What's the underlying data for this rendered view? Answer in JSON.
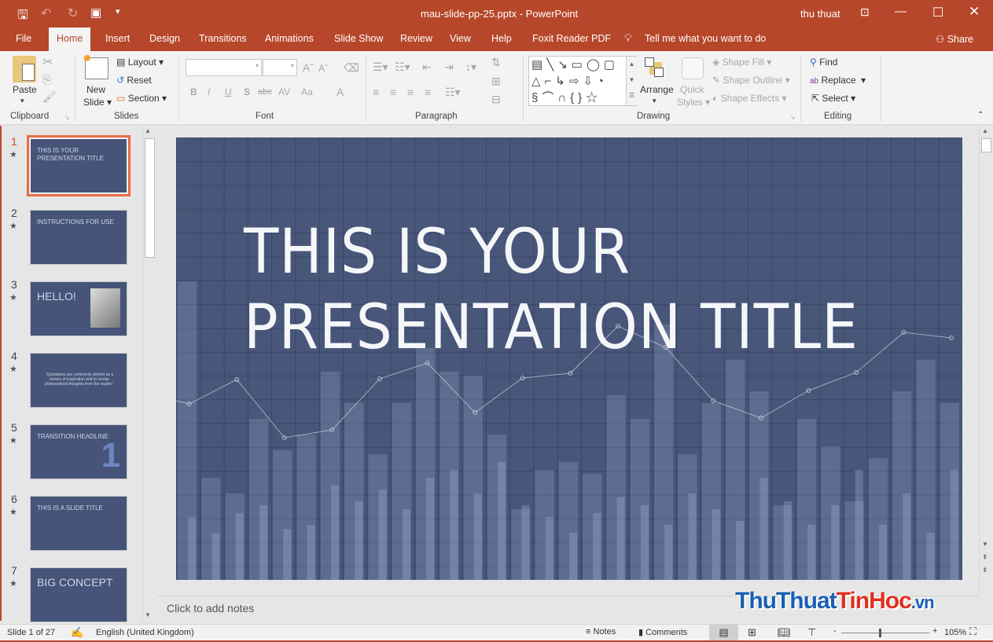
{
  "titlebar": {
    "quick_access": [
      "save-icon",
      "undo-icon",
      "redo-icon",
      "start-from-beginning-icon",
      "customize-icon"
    ],
    "title": "mau-slide-pp-25.pptx  -  PowerPoint",
    "user": "thu thuat"
  },
  "tabs": [
    "File",
    "Home",
    "Insert",
    "Design",
    "Transitions",
    "Animations",
    "Slide Show",
    "Review",
    "View",
    "Help",
    "Foxit Reader PDF"
  ],
  "tell_me": "Tell me what you want to do",
  "share": "Share",
  "ribbon": {
    "clipboard": {
      "label": "Clipboard",
      "paste": "Paste"
    },
    "slides": {
      "label": "Slides",
      "new_slide": "New",
      "new_slide2": "Slide",
      "layout": "Layout",
      "reset": "Reset",
      "section": "Section"
    },
    "font": {
      "label": "Font",
      "font_name": "",
      "font_size": "",
      "bold": "B",
      "italic": "I",
      "underline": "U",
      "shadow": "S",
      "strike": "abc",
      "spacing": "AV",
      "case": "Aa",
      "color": "A"
    },
    "paragraph": {
      "label": "Paragraph"
    },
    "drawing": {
      "label": "Drawing",
      "arrange": "Arrange",
      "quick_styles": "Quick",
      "quick_styles2": "Styles",
      "shape_fill": "Shape Fill",
      "shape_outline": "Shape Outline",
      "shape_effects": "Shape Effects"
    },
    "editing": {
      "label": "Editing",
      "find": "Find",
      "replace": "Replace",
      "select": "Select"
    }
  },
  "thumbnails": [
    {
      "num": "1",
      "title": "THIS IS YOUR PRESENTATION TITLE"
    },
    {
      "num": "2",
      "title": "INSTRUCTIONS FOR USE"
    },
    {
      "num": "3",
      "title": "HELLO!"
    },
    {
      "num": "4",
      "title": "“Quotations are commonly printed as a means of inspiration and to invoke philosophical thoughts from the reader.”"
    },
    {
      "num": "5",
      "title": "TRANSITION HEADLINE",
      "big": "1"
    },
    {
      "num": "6",
      "title": "THIS IS A SLIDE TITLE"
    },
    {
      "num": "7",
      "title": "BIG CONCEPT"
    }
  ],
  "slide": {
    "title_line1": "THIS IS YOUR",
    "title_line2": "PRESENTATION TITLE",
    "background": "#48567a"
  },
  "notes_placeholder": "Click to add notes",
  "watermark": {
    "text1": "ThuThuat",
    "text2": "TinHoc",
    "text3": ".vn"
  },
  "status": {
    "slide_info": "Slide 1 of 27",
    "language": "English (United Kingdom)",
    "notes": "Notes",
    "comments": "Comments",
    "zoom": "105%"
  },
  "colors": {
    "accent": "#b7472a",
    "selected_thumb": "#ea6b46"
  }
}
